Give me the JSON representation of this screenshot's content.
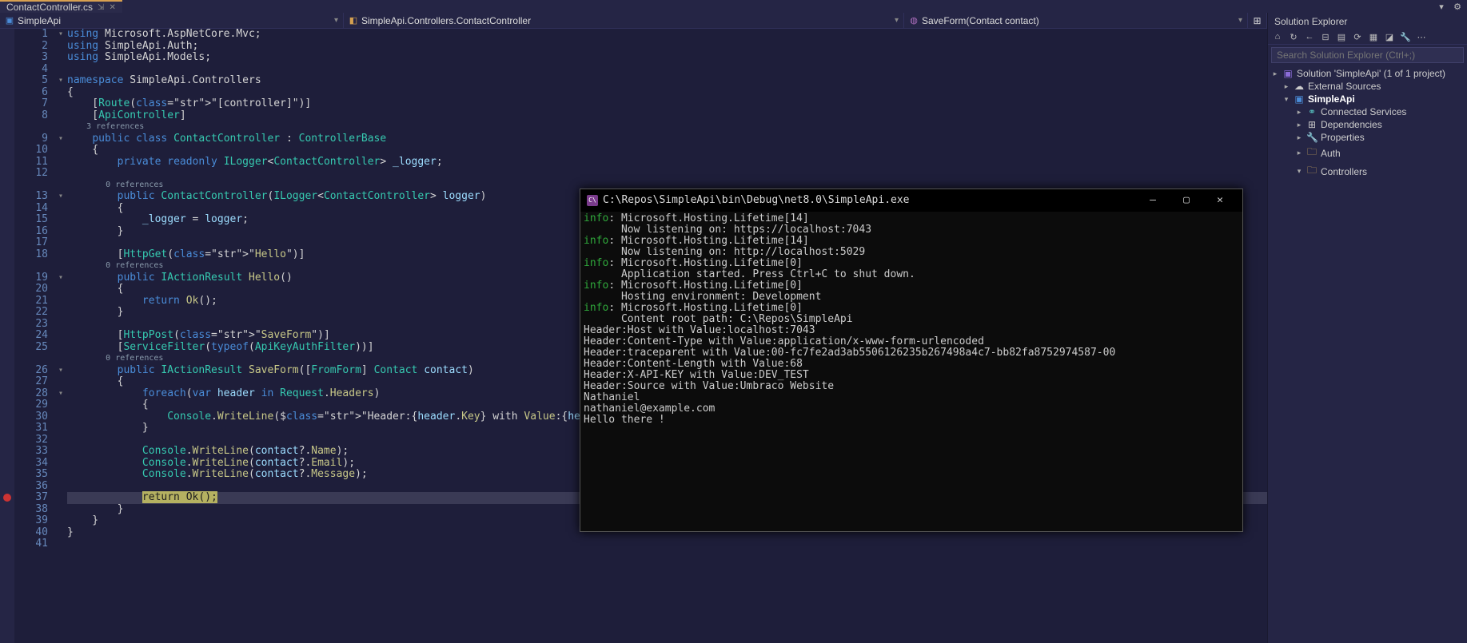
{
  "tab": {
    "name": "ContactController.cs"
  },
  "menu": {
    "dropdown": "▾",
    "gear": "⚙"
  },
  "nav": {
    "project": "SimpleApi",
    "class": "SimpleApi.Controllers.ContactController",
    "member": "SaveForm(Contact contact)"
  },
  "sln": {
    "title": "Solution Explorer",
    "search_ph": "Search Solution Explorer (Ctrl+;)",
    "root": "Solution 'SimpleApi' (1 of 1 project)",
    "ext": "External Sources",
    "proj": "SimpleApi",
    "svc": "Connected Services",
    "dep": "Dependencies",
    "prop": "Properties",
    "auth": "Auth",
    "ctrls": "Controllers"
  },
  "console": {
    "title": "C:\\Repos\\SimpleApi\\bin\\Debug\\net8.0\\SimpleApi.exe",
    "lines": [
      {
        "lvl": "info",
        "src": "Microsoft.Hosting.Lifetime[14]",
        "msg": "Now listening on: https://localhost:7043"
      },
      {
        "lvl": "info",
        "src": "Microsoft.Hosting.Lifetime[14]",
        "msg": "Now listening on: http://localhost:5029"
      },
      {
        "lvl": "info",
        "src": "Microsoft.Hosting.Lifetime[0]",
        "msg": "Application started. Press Ctrl+C to shut down."
      },
      {
        "lvl": "info",
        "src": "Microsoft.Hosting.Lifetime[0]",
        "msg": "Hosting environment: Development"
      },
      {
        "lvl": "info",
        "src": "Microsoft.Hosting.Lifetime[0]",
        "msg": "Content root path: C:\\Repos\\SimpleApi"
      }
    ],
    "plain": [
      "Header:Host with Value:localhost:7043",
      "Header:Content-Type with Value:application/x-www-form-urlencoded",
      "Header:traceparent with Value:00-fc7fe2ad3ab5506126235b267498a4c7-bb82fa8752974587-00",
      "Header:Content-Length with Value:68",
      "Header:X-API-KEY with Value:DEV_TEST",
      "Header:Source with Value:Umbraco Website",
      "Nathaniel",
      "nathaniel@example.com",
      "Hello there !"
    ]
  },
  "code": {
    "refs3": "3 references",
    "refs0a": "0 references",
    "refs0b": "0 references",
    "refs0c": "0 references",
    "lines": {
      "l1": "using Microsoft.AspNetCore.Mvc;",
      "l2": "using SimpleApi.Auth;",
      "l3": "using SimpleApi.Models;",
      "l4": "",
      "l5": "namespace SimpleApi.Controllers",
      "l6": "{",
      "l7": "    [Route(\"[controller]\")]",
      "l8": "    [ApiController]",
      "l9": "    public class ContactController : ControllerBase",
      "l10": "    {",
      "l11": "        private readonly ILogger<ContactController> _logger;",
      "l12": "",
      "l13": "        public ContactController(ILogger<ContactController> logger)",
      "l14": "        {",
      "l15": "            _logger = logger;",
      "l16": "        }",
      "l17": "",
      "l18": "        [HttpGet(\"Hello\")]",
      "l19": "        public IActionResult Hello()",
      "l20": "        {",
      "l21": "            return Ok();",
      "l22": "        }",
      "l23": "",
      "l24": "        [HttpPost(\"SaveForm\")]",
      "l25": "        [ServiceFilter(typeof(ApiKeyAuthFilter))]",
      "l26": "        public IActionResult SaveForm([FromForm] Contact contact)",
      "l27": "        {",
      "l28": "            foreach(var header in Request.Headers)",
      "l29": "            {",
      "l30": "                Console.WriteLine($\"Header:{header.Key} with Value:{header.Value}\");",
      "l31": "            }",
      "l32": "",
      "l33": "            Console.WriteLine(contact?.Name);",
      "l34": "            Console.WriteLine(contact?.Email);",
      "l35": "            Console.WriteLine(contact?.Message);",
      "l36": "",
      "l37": "            return Ok();",
      "l38": "        }",
      "l39": "    }",
      "l40": "}",
      "l41": ""
    }
  }
}
